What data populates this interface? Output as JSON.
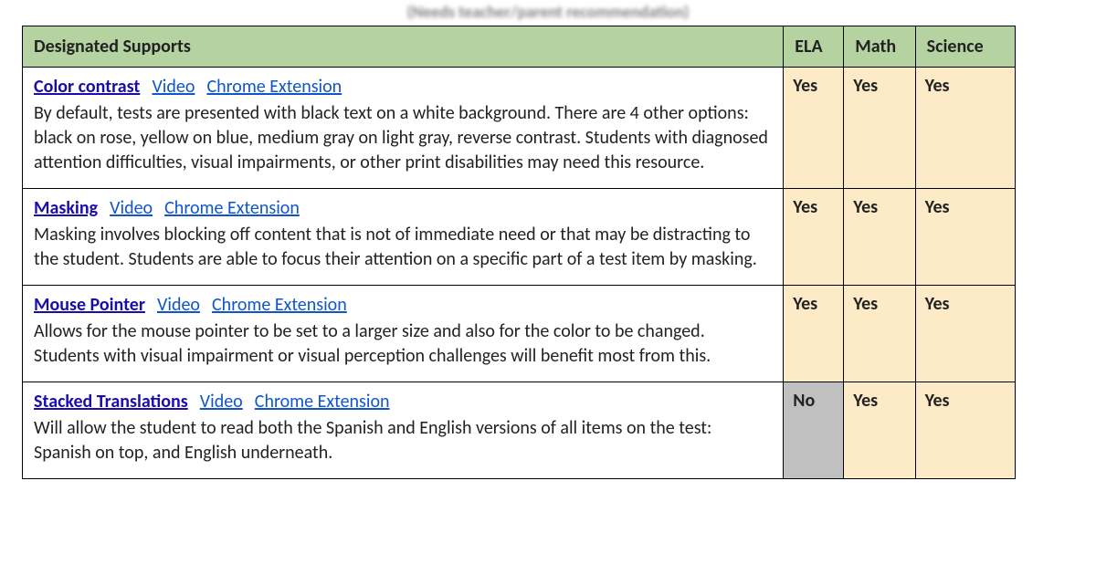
{
  "pretitle": "(Needs teacher/parent recommendation)",
  "headers": {
    "support": "Designated Supports",
    "ela": "ELA",
    "math": "Math",
    "science": "Science"
  },
  "rows": [
    {
      "title": "Color contrast",
      "video": "Video",
      "ext": "Chrome Extension",
      "body": "By default, tests are presented with black text on a white background. There are 4 other options: black on rose, yellow on blue, medium gray on light gray,  reverse contrast. Students with diagnosed attention difficulties, visual impairments, or other print disabilities may need this resource.",
      "ela": "Yes",
      "math": "Yes",
      "science": "Yes"
    },
    {
      "title": "Masking",
      "video": "Video",
      "ext": "Chrome Extension",
      "body": "Masking involves blocking off content that is not of immediate need or that may be distracting to the student. Students are able to focus their attention on a specific part of a test item by masking.",
      "ela": "Yes",
      "math": "Yes",
      "science": "Yes"
    },
    {
      "title": "Mouse Pointer",
      "video": "Video",
      "ext": "Chrome Extension",
      "body": "Allows for the mouse pointer to be set to a larger size and also for the color to be changed. Students with visual impairment or visual perception challenges will benefit most from this.",
      "ela": "Yes",
      "math": "Yes",
      "science": "Yes"
    },
    {
      "title": "Stacked Translations",
      "video": "Video",
      "ext": "Chrome Extension",
      "body": "Will allow the student to read both the Spanish and English versions of all items on the test: Spanish on top, and English underneath.",
      "ela": "No",
      "math": "Yes",
      "science": "Yes"
    }
  ]
}
